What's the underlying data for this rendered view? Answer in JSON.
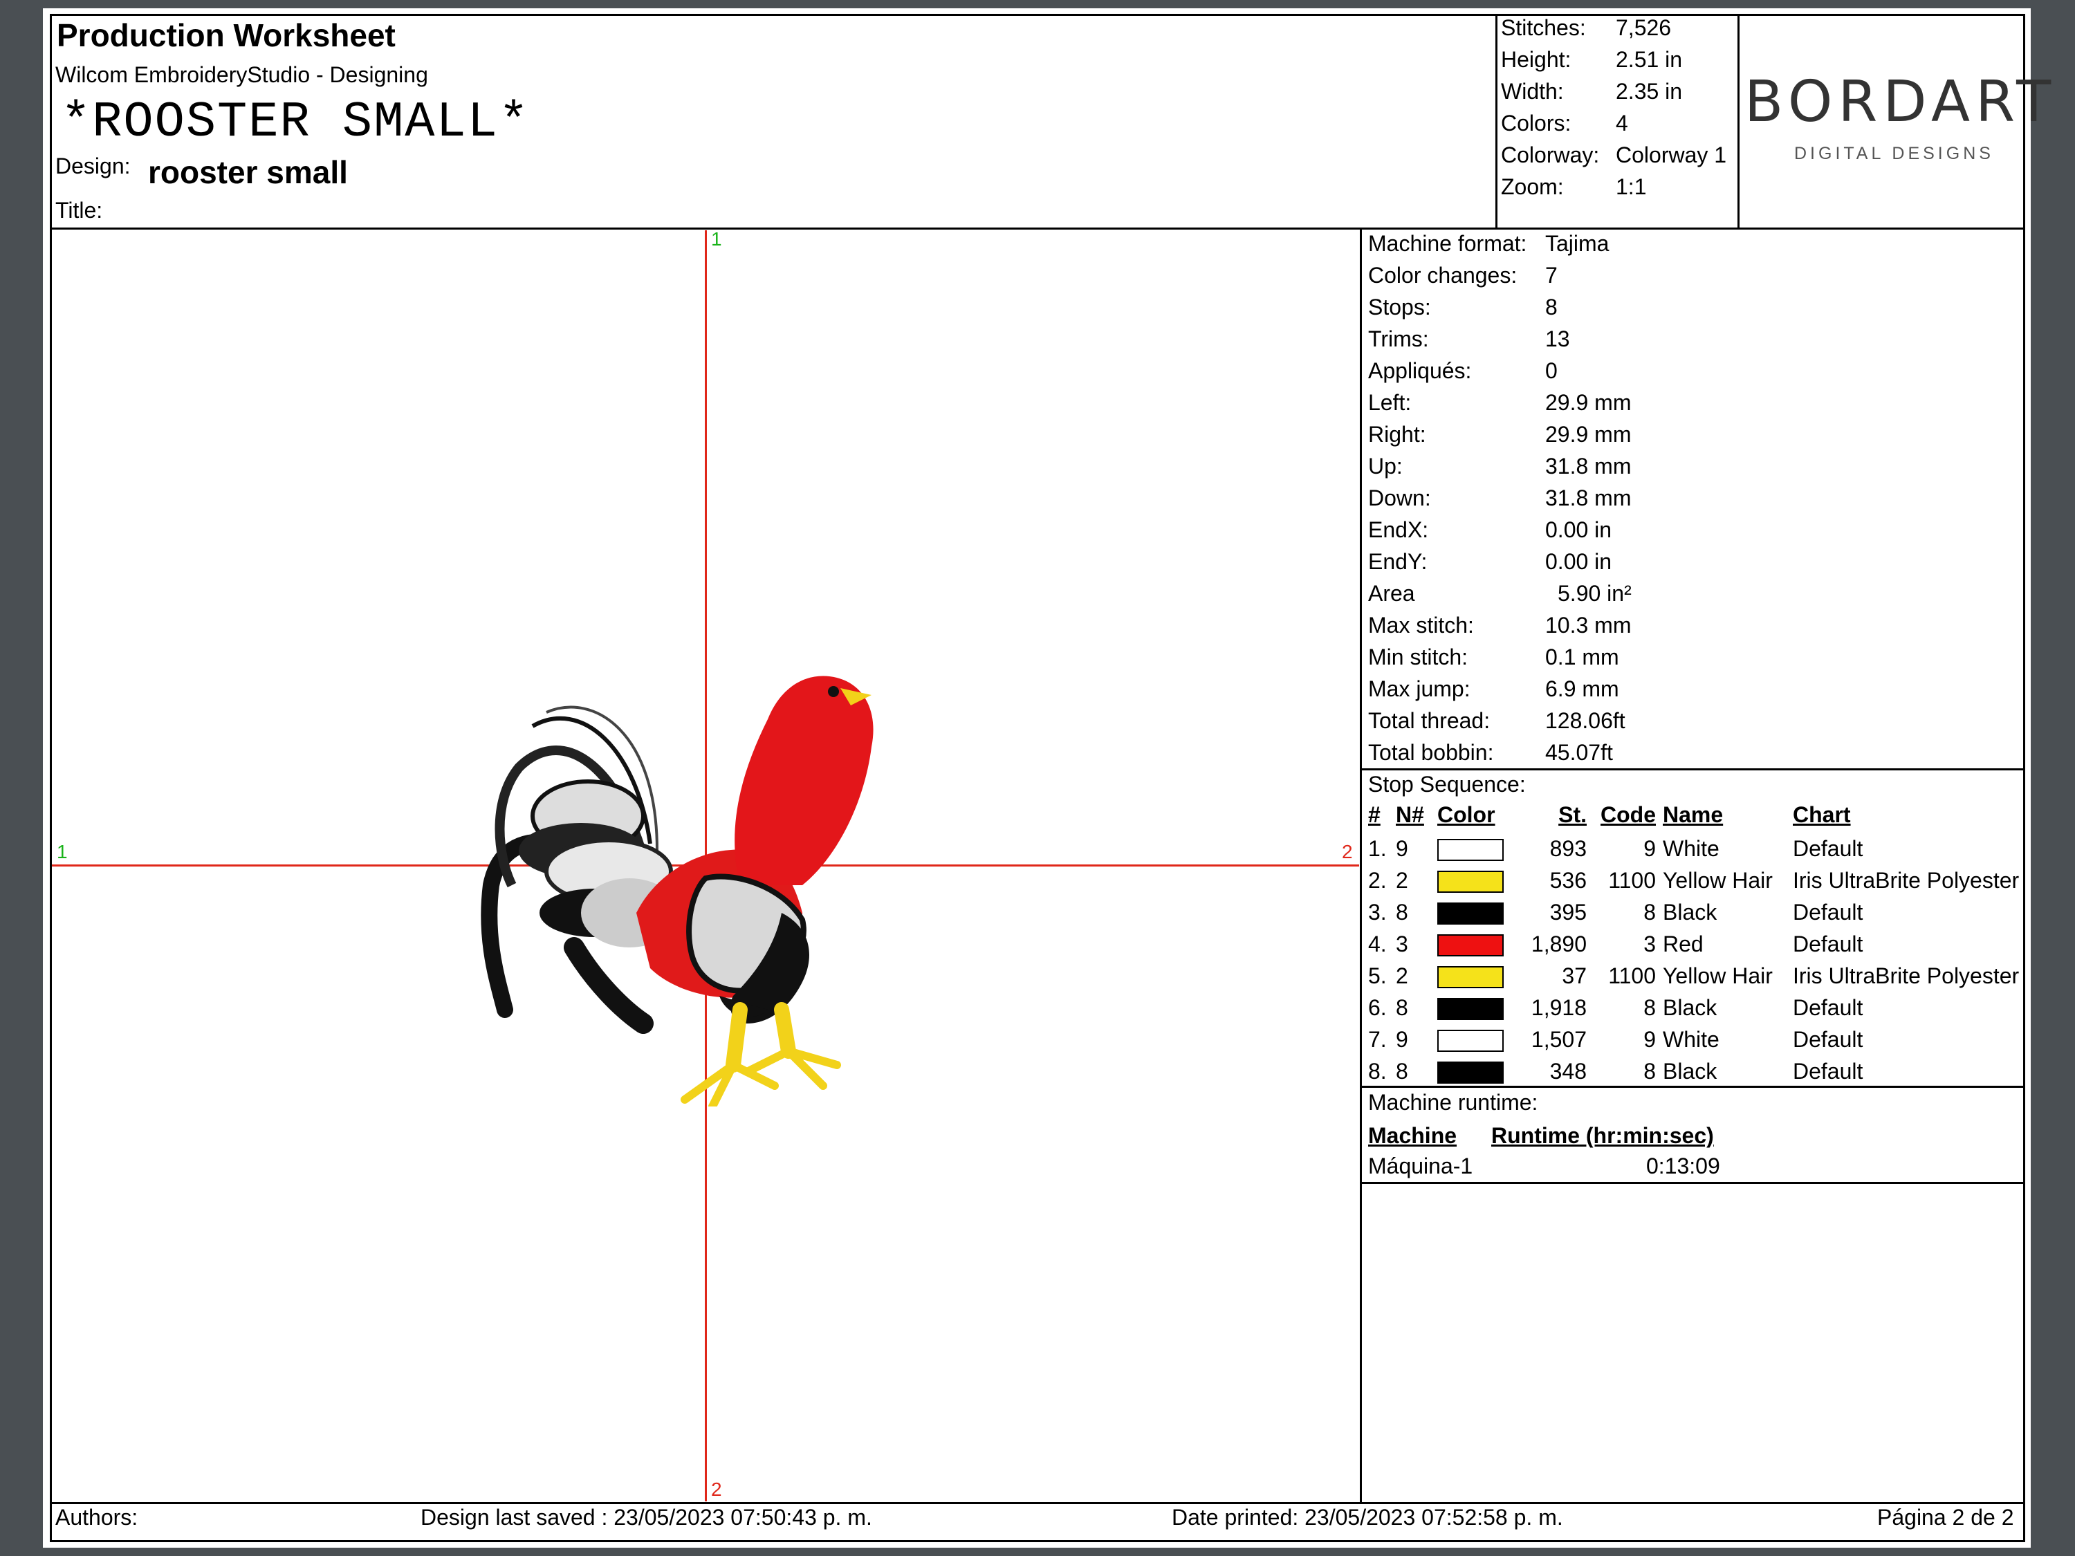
{
  "header": {
    "title": "Production Worksheet",
    "software": "Wilcom EmbroideryStudio - Designing",
    "design_banner": "*ROOSTER SMALL*",
    "design_label": "Design:",
    "design_name": "rooster small",
    "title_label": "Title:"
  },
  "summary": [
    {
      "label": "Stitches:",
      "value": "7,526"
    },
    {
      "label": "Height:",
      "value": "2.51 in"
    },
    {
      "label": "Width:",
      "value": "2.35 in"
    },
    {
      "label": "Colors:",
      "value": "4"
    },
    {
      "label": "Colorway:",
      "value": "Colorway 1"
    },
    {
      "label": "Zoom:",
      "value": "1:1"
    }
  ],
  "logo": {
    "name": "BORDART",
    "tagline": "DIGITAL DESIGNS"
  },
  "axes": {
    "top": "1",
    "bottom": "2",
    "left": "1",
    "right": "2"
  },
  "machine_info": [
    {
      "label": "Machine format:",
      "value": "Tajima"
    },
    {
      "label": "Color changes:",
      "value": "7"
    },
    {
      "label": "Stops:",
      "value": "8"
    },
    {
      "label": "Trims:",
      "value": "13"
    },
    {
      "label": "Appliqués:",
      "value": "0"
    },
    {
      "label": "Left:",
      "value": "29.9 mm"
    },
    {
      "label": "Right:",
      "value": "29.9 mm"
    },
    {
      "label": "Up:",
      "value": "31.8 mm"
    },
    {
      "label": "Down:",
      "value": "31.8 mm"
    },
    {
      "label": "EndX:",
      "value": "0.00 in"
    },
    {
      "label": "EndY:",
      "value": "0.00 in"
    },
    {
      "label": "Area",
      "value": "5.90 in²"
    },
    {
      "label": "Max stitch:",
      "value": "10.3 mm"
    },
    {
      "label": "Min stitch:",
      "value": "0.1 mm"
    },
    {
      "label": "Max jump:",
      "value": "6.9 mm"
    },
    {
      "label": "Total thread:",
      "value": "128.06ft"
    },
    {
      "label": "Total bobbin:",
      "value": "45.07ft"
    }
  ],
  "stop_sequence": {
    "title": "Stop Sequence:",
    "headers": [
      "#",
      "N#",
      "Color",
      "St.",
      "Code",
      "Name",
      "Chart"
    ],
    "rows": [
      {
        "idx": "1.",
        "n": "9",
        "color": "#ffffff",
        "st": "893",
        "code": "9",
        "name": "White",
        "chart": "Default"
      },
      {
        "idx": "2.",
        "n": "2",
        "color": "#f5e21a",
        "st": "536",
        "code": "1100",
        "name": "Yellow Hair",
        "chart": "Iris UltraBrite Polyester"
      },
      {
        "idx": "3.",
        "n": "8",
        "color": "#000000",
        "st": "395",
        "code": "8",
        "name": "Black",
        "chart": "Default"
      },
      {
        "idx": "4.",
        "n": "3",
        "color": "#ee1111",
        "st": "1,890",
        "code": "3",
        "name": "Red",
        "chart": "Default"
      },
      {
        "idx": "5.",
        "n": "2",
        "color": "#f5e21a",
        "st": "37",
        "code": "1100",
        "name": "Yellow Hair",
        "chart": "Iris UltraBrite Polyester"
      },
      {
        "idx": "6.",
        "n": "8",
        "color": "#000000",
        "st": "1,918",
        "code": "8",
        "name": "Black",
        "chart": "Default"
      },
      {
        "idx": "7.",
        "n": "9",
        "color": "#ffffff",
        "st": "1,507",
        "code": "9",
        "name": "White",
        "chart": "Default"
      },
      {
        "idx": "8.",
        "n": "8",
        "color": "#000000",
        "st": "348",
        "code": "8",
        "name": "Black",
        "chart": "Default"
      }
    ]
  },
  "runtime": {
    "title": "Machine runtime:",
    "col_machine": "Machine",
    "col_runtime": "Runtime (hr:min:sec)",
    "machine": "Máquina-1",
    "time": "0:13:09"
  },
  "footer": {
    "authors": "Authors:",
    "saved": "Design last saved : 23/05/2023 07:50:43 p. m.",
    "printed": "Date printed: 23/05/2023 07:52:58 p. m.",
    "page": "Página 2 de 2"
  }
}
